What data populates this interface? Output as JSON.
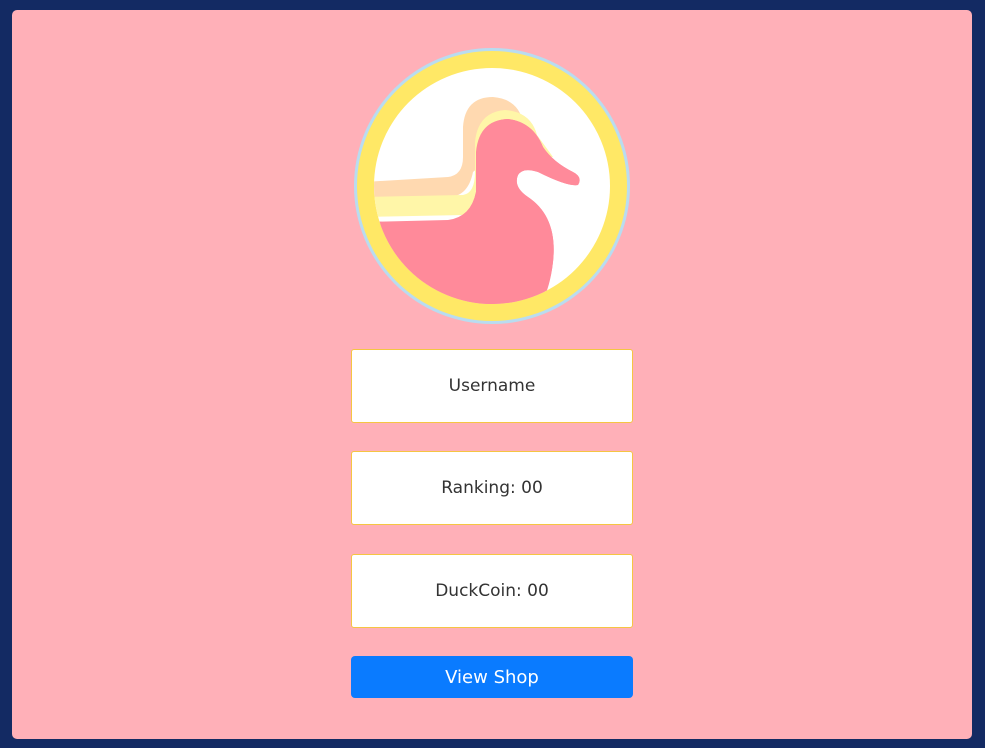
{
  "profile": {
    "avatar_icon": "duck-logo-icon",
    "username": "Username",
    "ranking": "Ranking: 00",
    "duckcoin": "DuckCoin: 00"
  },
  "actions": {
    "view_shop_label": "View Shop"
  },
  "colors": {
    "page_background": "#132a63",
    "panel_background": "#ffb0b8",
    "button_blue": "#0a7bff",
    "box_border": "#f5c542",
    "duck_pink": "#ff8a9a",
    "ring_yellow": "#ffe866"
  }
}
